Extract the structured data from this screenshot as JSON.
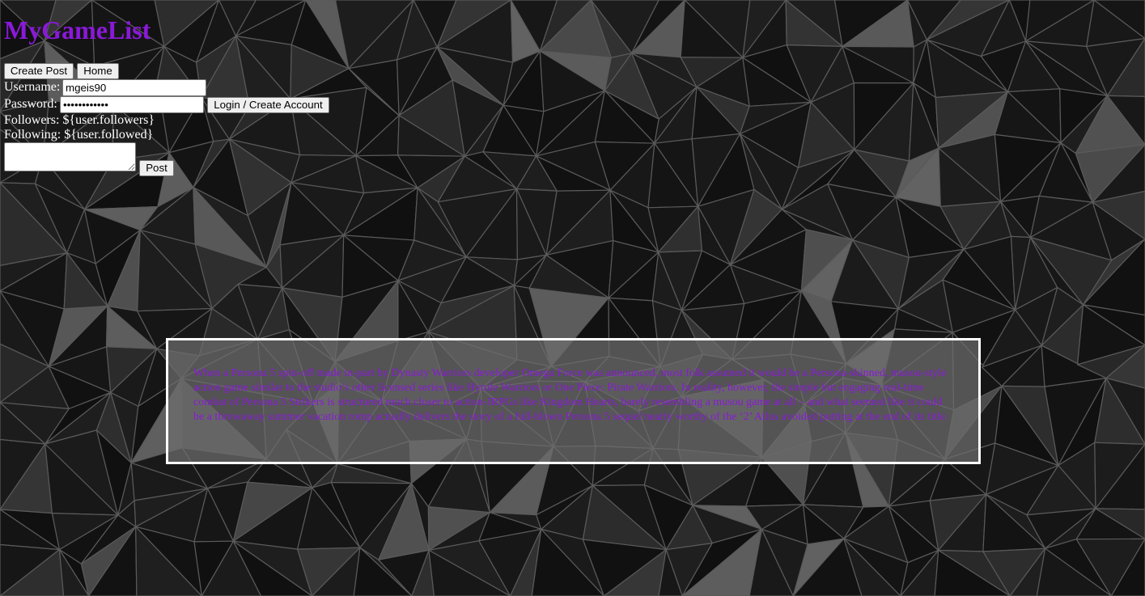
{
  "site": {
    "title": "MyGameList",
    "title_color": "#8a19d9"
  },
  "nav": {
    "create_post_label": "Create Post",
    "home_label": "Home"
  },
  "login": {
    "username_label": "Username:",
    "username_value": "mgeis90",
    "password_label": "Password:",
    "password_value": "••••••••••••",
    "submit_label": "Login / Create Account"
  },
  "profile": {
    "followers_text": "Followers: ${user.followers}",
    "following_text": "Following: ${user.followed}"
  },
  "composer": {
    "textarea_value": "",
    "post_label": "Post"
  },
  "review": {
    "text": "When a Persona 5 spin-off made in-part by Dynasty Warriors developer Omega Force was announced, most folk assumed it would be a Persona-skinned, musou-style action game similar to the studio’s other licensed series like Hyrule Warriors or One Piece: Pirate Warriors. In reality, however, the simple but engaging real-time combat of Persona 5 Strikers is structured much closer to action-JRPGs like Kingdom Hearts, barely resembling a musou game at all – and what seemed like it could be a throwaway summer vacation romp actually delivers the story of a full-blown Persona 5 sequel nearly worthy of the ‘2’ Atlus avoided putting at the end of its title."
  },
  "colors": {
    "background": "#1a1a1a",
    "accent": "#8a19d9",
    "review_border": "#ffffff"
  },
  "icons": {
    "background": "low-poly-triangle-pattern"
  }
}
